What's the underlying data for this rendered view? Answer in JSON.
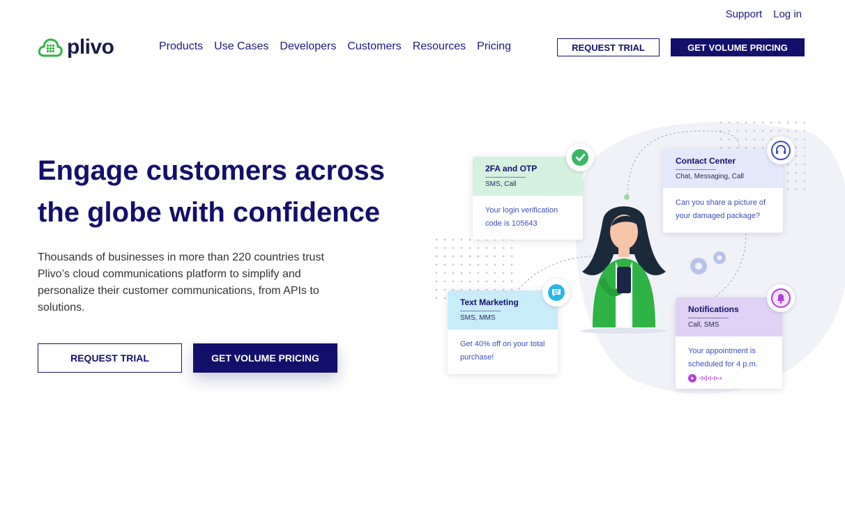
{
  "topbar": {
    "support": "Support",
    "login": "Log in"
  },
  "brand": {
    "name": "plivo",
    "logo_icon": "cloud-grid-icon",
    "color": "#2fb344"
  },
  "nav": [
    "Products",
    "Use Cases",
    "Developers",
    "Customers",
    "Resources",
    "Pricing"
  ],
  "header_buttons": {
    "trial": "REQUEST TRIAL",
    "volume": "GET VOLUME PRICING"
  },
  "hero": {
    "title": "Engage customers across the globe with confidence",
    "subtitle": "Thousands of businesses in more than 220 countries trust Plivo’s cloud communications platform to simplify and personalize their customer communications, from APIs to solutions.",
    "trial_button": "REQUEST TRIAL",
    "volume_button": "GET VOLUME PRICING"
  },
  "cards": {
    "twofa": {
      "title": "2FA and OTP",
      "channels": "SMS, Call",
      "body": "Your login verification code is 105643",
      "icon": "shield-check-icon",
      "color": "#d5f2e0"
    },
    "contact": {
      "title": "Contact Center",
      "channels": "Chat, Messaging, Call",
      "body": "Can you share a picture of your damaged package?",
      "icon": "headset-icon",
      "color": "#e3e8fb"
    },
    "marketing": {
      "title": "Text Marketing",
      "channels": "SMS, MMS",
      "body": "Get 40% off on your total purchase!",
      "icon": "chat-bubble-icon",
      "color": "#c9ecfb"
    },
    "notifications": {
      "title": "Notifications",
      "channels": "Call, SMS",
      "body": "Your appointment is scheduled for 4 p.m.",
      "icon": "bell-icon",
      "color": "#e0d2f4"
    }
  },
  "colors": {
    "primary": "#12106b",
    "accent_green": "#2fb344"
  }
}
